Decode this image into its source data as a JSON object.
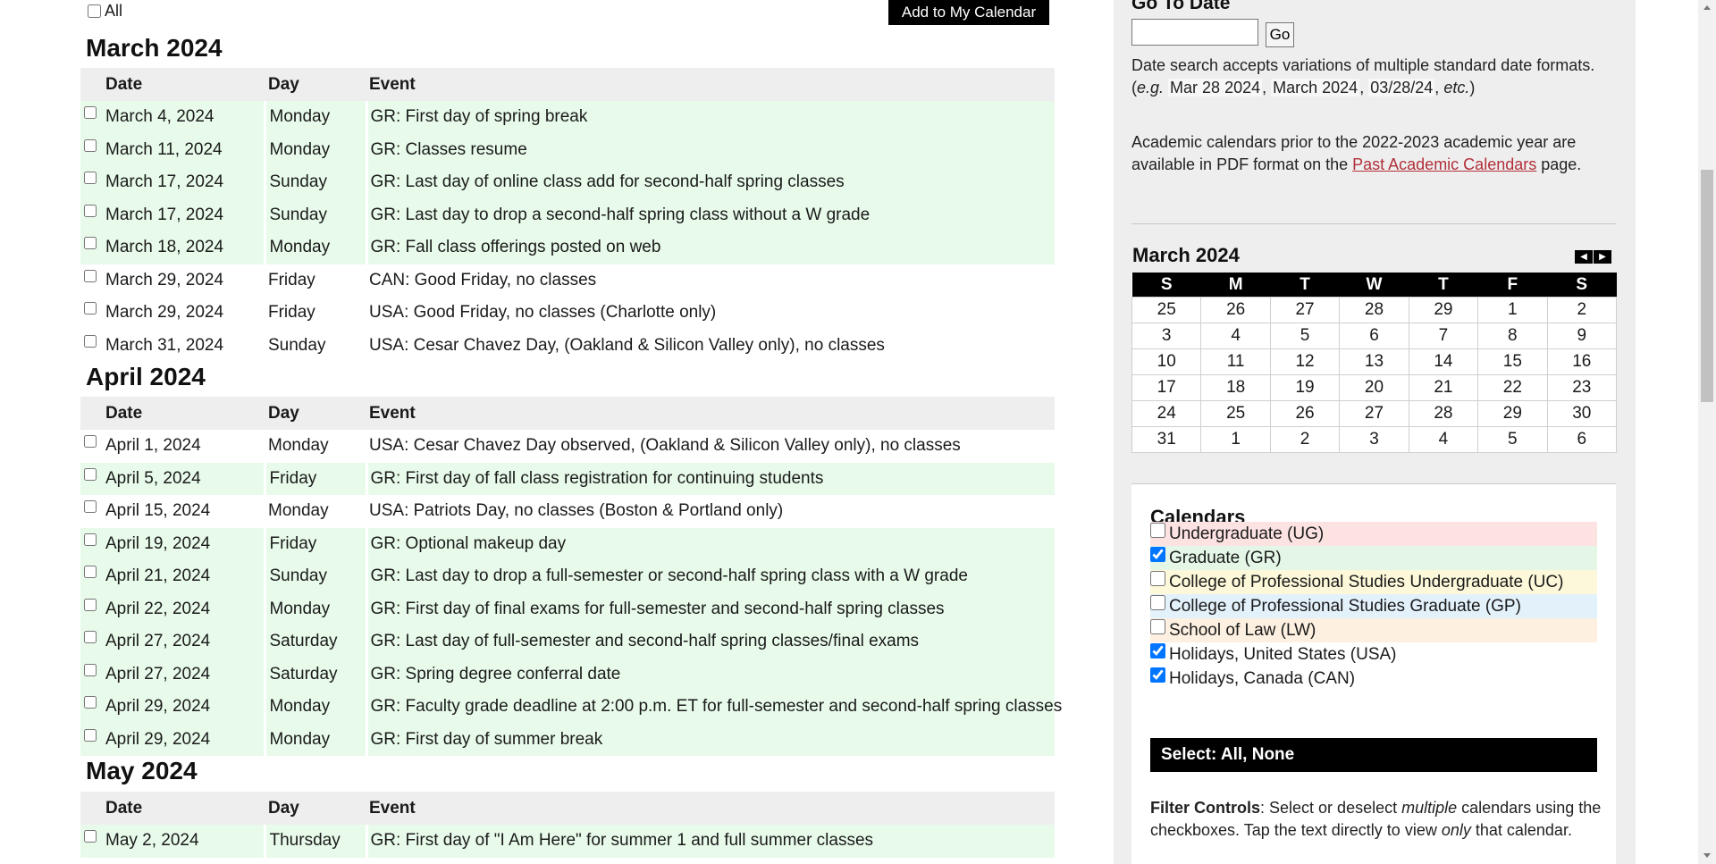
{
  "header": {
    "all_label": "All",
    "add_button": "Add to My Calendar"
  },
  "columns": {
    "date": "Date",
    "day": "Day",
    "event": "Event"
  },
  "months": [
    {
      "title": "March 2024",
      "events": [
        {
          "date": "March 4, 2024",
          "day": "Monday",
          "event": "GR: First day of spring break",
          "cal": "GR"
        },
        {
          "date": "March 11, 2024",
          "day": "Monday",
          "event": "GR: Classes resume",
          "cal": "GR"
        },
        {
          "date": "March 17, 2024",
          "day": "Sunday",
          "event": "GR: Last day of online class add for second-half spring classes",
          "cal": "GR"
        },
        {
          "date": "March 17, 2024",
          "day": "Sunday",
          "event": "GR: Last day to drop a second-half spring class without a W grade",
          "cal": "GR"
        },
        {
          "date": "March 18, 2024",
          "day": "Monday",
          "event": "GR: Fall class offerings posted on web",
          "cal": "GR"
        },
        {
          "date": "March 29, 2024",
          "day": "Friday",
          "event": "CAN: Good Friday, no classes",
          "cal": "CAN"
        },
        {
          "date": "March 29, 2024",
          "day": "Friday",
          "event": "USA: Good Friday, no classes (Charlotte only)",
          "cal": "USA"
        },
        {
          "date": "March 31, 2024",
          "day": "Sunday",
          "event": "USA: Cesar Chavez Day, (Oakland & Silicon Valley only), no classes",
          "cal": "USA"
        }
      ]
    },
    {
      "title": "April 2024",
      "events": [
        {
          "date": "April 1, 2024",
          "day": "Monday",
          "event": "USA: Cesar Chavez Day observed, (Oakland & Silicon Valley only), no classes",
          "cal": "USA"
        },
        {
          "date": "April 5, 2024",
          "day": "Friday",
          "event": "GR: First day of fall class registration for continuing students",
          "cal": "GR"
        },
        {
          "date": "April 15, 2024",
          "day": "Monday",
          "event": "USA: Patriots Day, no classes (Boston & Portland only)",
          "cal": "USA"
        },
        {
          "date": "April 19, 2024",
          "day": "Friday",
          "event": "GR: Optional makeup day",
          "cal": "GR"
        },
        {
          "date": "April 21, 2024",
          "day": "Sunday",
          "event": "GR: Last day to drop a full-semester or second-half spring class with a W grade",
          "cal": "GR"
        },
        {
          "date": "April 22, 2024",
          "day": "Monday",
          "event": "GR: First day of final exams for full-semester and second-half spring classes",
          "cal": "GR"
        },
        {
          "date": "April 27, 2024",
          "day": "Saturday",
          "event": "GR: Last day of full-semester and second-half spring classes/final exams",
          "cal": "GR"
        },
        {
          "date": "April 27, 2024",
          "day": "Saturday",
          "event": "GR: Spring degree conferral date",
          "cal": "GR"
        },
        {
          "date": "April 29, 2024",
          "day": "Monday",
          "event": "GR: Faculty grade deadline at 2:00 p.m. ET for full-semester and second-half spring classes",
          "cal": "GR"
        },
        {
          "date": "April 29, 2024",
          "day": "Monday",
          "event": "GR: First day of summer break",
          "cal": "GR"
        }
      ]
    },
    {
      "title": "May 2024",
      "events": [
        {
          "date": "May 2, 2024",
          "day": "Thursday",
          "event": "GR: First day of \"I Am Here\" for summer 1 and full summer classes",
          "cal": "GR"
        }
      ]
    }
  ],
  "sidebar": {
    "goto_title": "Go To Date",
    "go_button": "Go",
    "goto_value": "",
    "search_p1": "Date search accepts variations of multiple standard date formats. (",
    "search_eg": "e.g.",
    "search_ex1": "Mar 28 2024",
    "search_ex2": "March 2024",
    "search_ex3": "03/28/24",
    "search_etc": "etc.",
    "search_close": ")",
    "past_p1": "Academic calendars prior to the 2022-2023 academic year are available in PDF format on the ",
    "past_link": "Past Academic Calendars",
    "past_p2": " page.",
    "mini": {
      "title": "March 2024",
      "prev_icon": "◀",
      "next_icon": "▶",
      "weekdays": [
        "S",
        "M",
        "T",
        "W",
        "T",
        "F",
        "S"
      ],
      "weeks": [
        [
          "25",
          "26",
          "27",
          "28",
          "29",
          "1",
          "2"
        ],
        [
          "3",
          "4",
          "5",
          "6",
          "7",
          "8",
          "9"
        ],
        [
          "10",
          "11",
          "12",
          "13",
          "14",
          "15",
          "16"
        ],
        [
          "17",
          "18",
          "19",
          "20",
          "21",
          "22",
          "23"
        ],
        [
          "24",
          "25",
          "26",
          "27",
          "28",
          "29",
          "30"
        ],
        [
          "31",
          "1",
          "2",
          "3",
          "4",
          "5",
          "6"
        ]
      ]
    },
    "calendars_title": "Calendars",
    "calendars": [
      {
        "label": "Undergraduate (UG)",
        "checked": false,
        "color": "#fde2e2"
      },
      {
        "label": "Graduate (GR)",
        "checked": true,
        "color": "#e4f7e6"
      },
      {
        "label": "College of Professional Studies Undergraduate (UC)",
        "checked": false,
        "color": "#fdf8d9"
      },
      {
        "label": "College of Professional Studies Graduate (GP)",
        "checked": false,
        "color": "#e3f1fb"
      },
      {
        "label": "School of Law (LW)",
        "checked": false,
        "color": "#fdf0e0"
      },
      {
        "label": "Holidays, United States (USA)",
        "checked": true,
        "color": "#ffffff"
      },
      {
        "label": "Holidays, Canada (CAN)",
        "checked": true,
        "color": "#ffffff"
      }
    ],
    "select_bar": "Select: All, None",
    "filter_bold": "Filter Controls",
    "filter_p1": ": Select or deselect ",
    "filter_em1": "multiple",
    "filter_p2": " calendars using the checkboxes. Tap the text directly to view ",
    "filter_em2": "only",
    "filter_p3": " that calendar."
  }
}
